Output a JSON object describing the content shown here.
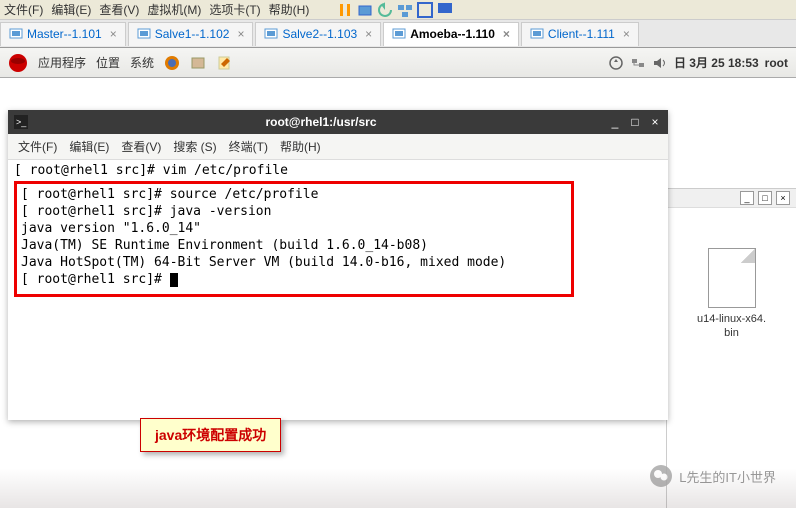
{
  "vm_menu": {
    "file": "文件(F)",
    "edit": "编辑(E)",
    "view": "查看(V)",
    "vm": "虚拟机(M)",
    "tabs": "选项卡(T)",
    "help": "帮助(H)"
  },
  "tabs": [
    {
      "label": "Master--1.101",
      "active": false
    },
    {
      "label": "Salve1--1.102",
      "active": false
    },
    {
      "label": "Salve2--1.103",
      "active": false
    },
    {
      "label": "Amoeba--1.110",
      "active": true
    },
    {
      "label": "Client--1.111",
      "active": false
    }
  ],
  "desktop": {
    "apps": "应用程序",
    "places": "位置",
    "system": "系统",
    "date": "日 3月 25 18:53",
    "user": "root"
  },
  "terminal": {
    "title": "root@rhel1:/usr/src",
    "menu": {
      "file": "文件(F)",
      "edit": "编辑(E)",
      "view": "查看(V)",
      "search": "搜索 (S)",
      "terminal": "终端(T)",
      "help": "帮助(H)"
    },
    "lines": {
      "l0": "[ root@rhel1 src]# vim /etc/profile",
      "l1": "[ root@rhel1 src]# source /etc/profile",
      "l2": "[ root@rhel1 src]# java -version",
      "l3": "java version \"1.6.0_14\"",
      "l4": "Java(TM) SE Runtime Environment (build 1.6.0_14-b08)",
      "l5": "Java HotSpot(TM) 64-Bit Server VM (build 14.0-b16, mixed mode)",
      "l6": "[ root@rhel1 src]# "
    }
  },
  "callout": "java环境配置成功",
  "file": {
    "name_line1": "u14-linux-x64.",
    "name_line2": "bin"
  },
  "watermark": "L先生的IT小世界"
}
